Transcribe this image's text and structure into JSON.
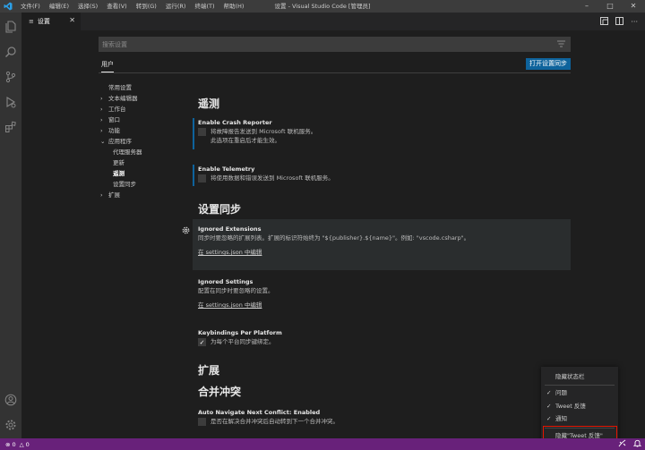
{
  "titlebar": {
    "menu": [
      "文件(F)",
      "编辑(E)",
      "选择(S)",
      "查看(V)",
      "转到(G)",
      "运行(R)",
      "终端(T)",
      "帮助(H)"
    ],
    "window_title": "设置 - Visual Studio Code [管理员]",
    "logo_icon": "vscode-logo-icon"
  },
  "tab": {
    "label": "设置"
  },
  "search": {
    "placeholder": "搜索设置"
  },
  "scope": {
    "user_tab": "用户",
    "sync_button": "打开设置同步"
  },
  "toc": {
    "items": [
      "常用设置",
      "文本编辑器",
      "工作台",
      "窗口",
      "功能",
      "应用程序",
      "代理服务器",
      "更新",
      "遥测",
      "设置同步",
      "扩展"
    ]
  },
  "sections": {
    "telemetry": "遥测",
    "sync": "设置同步",
    "extensions": "扩展",
    "merge": "合并冲突"
  },
  "settings": {
    "crash": {
      "title": "Enable Crash Reporter",
      "desc1": "将故障报告发送到 Microsoft 联机服务。",
      "desc2": "此选项在重启后才能生效。"
    },
    "telemetry": {
      "title": "Enable Telemetry",
      "desc": "将使用数据和错误发送到 Microsoft 联机服务。"
    },
    "ignored_ext": {
      "title": "Ignored Extensions",
      "desc": "同步时要忽略的扩展列表。扩展的标识符始终为 \"${publisher}.${name}\"。例如: \"vscode.csharp\"。",
      "link": "在 settings.json 中编辑"
    },
    "ignored_settings": {
      "title": "Ignored Settings",
      "desc": "配置在同步时要忽略的设置。",
      "link": "在 settings.json 中编辑"
    },
    "keybindings": {
      "title": "Keybindings Per Platform",
      "desc": "为每个平台同步键绑定。",
      "checked": true
    },
    "auto_nav": {
      "title_prefix": "Auto Navigate Next Conflict: ",
      "title_value": "Enabled",
      "desc": "是否在解决合并冲突后自动转到下一个合并冲突。"
    }
  },
  "context_menu": {
    "header": "隐藏状态栏",
    "items": [
      "问题",
      "Tweet 反馈",
      "通知"
    ],
    "hide_tweet": "隐藏\"Tweet 反馈\""
  },
  "status": {
    "errors": "0",
    "warnings": "0"
  },
  "colors": {
    "statusbar": "#68217a",
    "accent_button": "#0e639c",
    "highlight_border": "#e51400"
  }
}
